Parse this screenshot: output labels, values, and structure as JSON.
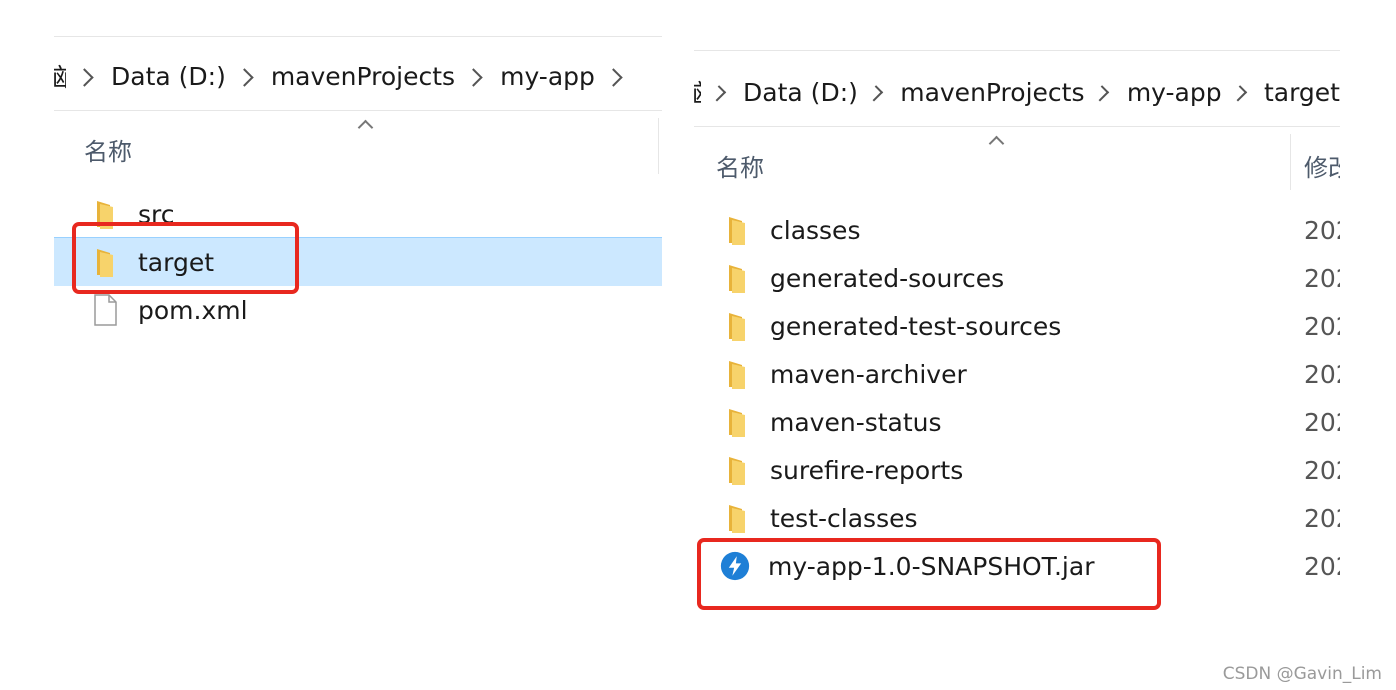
{
  "left_window": {
    "breadcrumb": {
      "truncated": "脑",
      "items": [
        "Data (D:)",
        "mavenProjects",
        "my-app"
      ]
    },
    "column_header": "名称",
    "files": [
      {
        "name": "src",
        "type": "folder",
        "selected": false
      },
      {
        "name": "target",
        "type": "folder",
        "selected": true
      },
      {
        "name": "pom.xml",
        "type": "file",
        "selected": false
      }
    ]
  },
  "right_window": {
    "breadcrumb": {
      "truncated": "脑",
      "items": [
        "Data (D:)",
        "mavenProjects",
        "my-app",
        "target"
      ]
    },
    "column_header": "名称",
    "column_header_2": "修改日期",
    "files": [
      {
        "name": "classes",
        "type": "folder",
        "date": "202"
      },
      {
        "name": "generated-sources",
        "type": "folder",
        "date": "202"
      },
      {
        "name": "generated-test-sources",
        "type": "folder",
        "date": "202"
      },
      {
        "name": "maven-archiver",
        "type": "folder",
        "date": "202"
      },
      {
        "name": "maven-status",
        "type": "folder",
        "date": "202"
      },
      {
        "name": "surefire-reports",
        "type": "folder",
        "date": "202"
      },
      {
        "name": "test-classes",
        "type": "folder",
        "date": "202"
      },
      {
        "name": "my-app-1.0-SNAPSHOT.jar",
        "type": "jar",
        "date": "202"
      }
    ]
  },
  "watermark": "CSDN @Gavin_Lim",
  "colors": {
    "selection": "#cce8ff",
    "highlight_box": "#e8281f",
    "folder": "#f4c74f",
    "jar_icon": "#1e7fd6"
  }
}
